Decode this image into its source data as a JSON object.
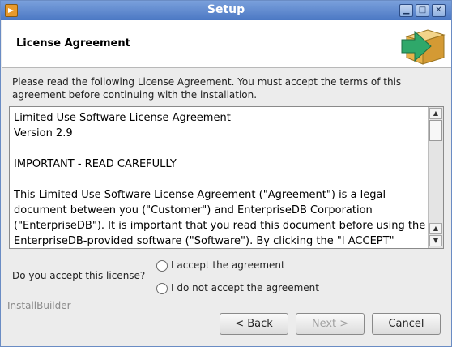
{
  "window": {
    "title": "Setup"
  },
  "header": {
    "title": "License Agreement"
  },
  "instructions": "Please read the following License Agreement. You must accept the terms of this agreement before continuing with the installation.",
  "license": {
    "line1": "Limited Use Software License Agreement",
    "line2": "Version 2.9",
    "line3": "IMPORTANT - READ CAREFULLY",
    "line4": "This Limited Use Software License Agreement (\"Agreement\") is a legal document between you (\"Customer\") and EnterpriseDB Corporation (\"EnterpriseDB\"). It is important that you read this document before using the EnterpriseDB-provided software (\"Software\"). By clicking the \"I ACCEPT\" button,"
  },
  "question": "Do you accept this license?",
  "options": {
    "accept": "I accept the agreement",
    "decline": "I do not accept the agreement"
  },
  "brand": "InstallBuilder",
  "buttons": {
    "back": "< Back",
    "next": "Next >",
    "cancel": "Cancel"
  },
  "colors": {
    "titlebar": "#4b78c4",
    "accent_arrow": "#3cb371",
    "box": "#e8c06a"
  }
}
